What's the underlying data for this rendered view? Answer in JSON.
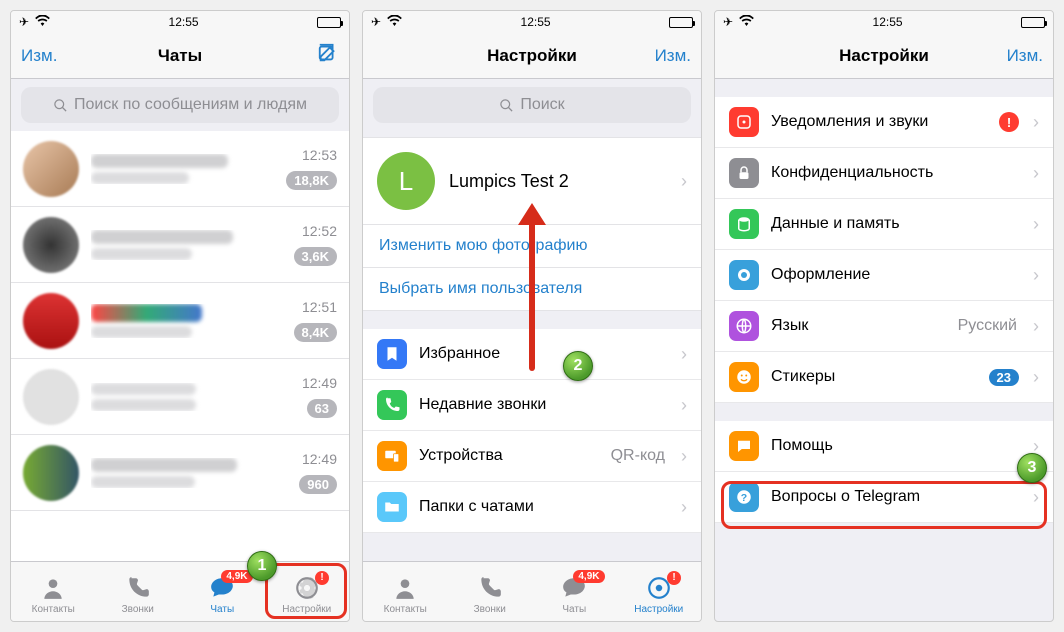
{
  "status": {
    "time": "12:55"
  },
  "phone1": {
    "nav": {
      "edit": "Изм.",
      "title": "Чаты"
    },
    "search_placeholder": "Поиск по сообщениям и людям",
    "chats": [
      {
        "time": "12:53",
        "badge": "18,8K"
      },
      {
        "time": "12:52",
        "badge": "3,6K"
      },
      {
        "time": "12:51",
        "badge": "8,4K"
      },
      {
        "time": "12:49",
        "badge": "63"
      },
      {
        "time": "12:49",
        "badge": "960"
      }
    ],
    "tabs": {
      "contacts": "Контакты",
      "calls": "Звонки",
      "chats": "Чаты",
      "chats_badge": "4,9K",
      "settings": "Настройки"
    },
    "step_num": "1"
  },
  "phone2": {
    "nav": {
      "title": "Настройки",
      "edit": "Изм."
    },
    "search_placeholder": "Поиск",
    "profile": {
      "initial": "L",
      "name": "Lumpics Test 2"
    },
    "links": {
      "photo": "Изменить мою фотографию",
      "username": "Выбрать имя пользователя"
    },
    "rows": {
      "saved": "Избранное",
      "calls": "Недавние звонки",
      "devices": "Устройства",
      "devices_val": "QR-код",
      "folders": "Папки с чатами"
    },
    "tabs": {
      "contacts": "Контакты",
      "calls": "Звонки",
      "chats": "Чаты",
      "chats_badge": "4,9K",
      "settings": "Настройки"
    },
    "step_num": "2"
  },
  "phone3": {
    "nav": {
      "title": "Настройки",
      "edit": "Изм."
    },
    "rows": {
      "notifications": "Уведомления и звуки",
      "privacy": "Конфиденциальность",
      "data": "Данные и память",
      "appearance": "Оформление",
      "language": "Язык",
      "language_val": "Русский",
      "stickers": "Стикеры",
      "stickers_badge": "23",
      "help": "Помощь",
      "faq": "Вопросы о Telegram"
    },
    "step_num": "3"
  }
}
